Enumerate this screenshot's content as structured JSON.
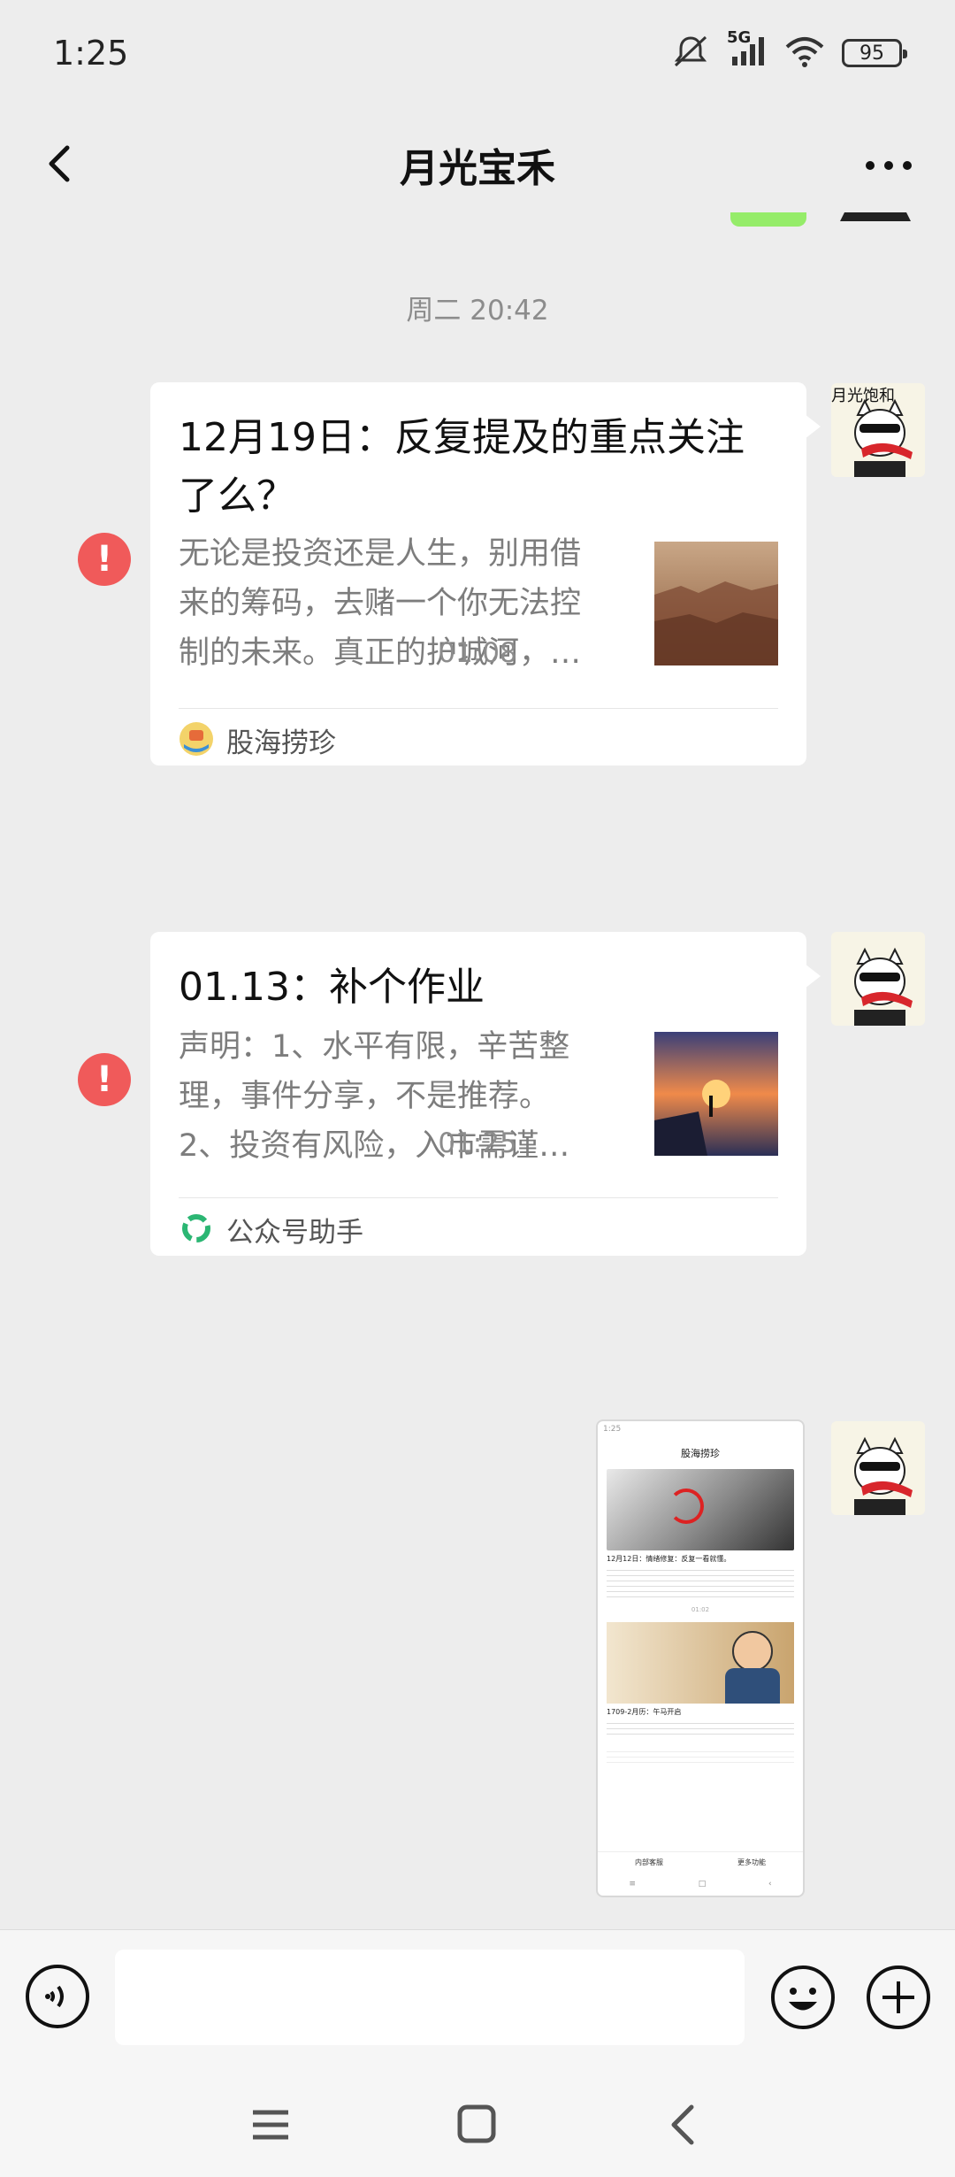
{
  "status_bar": {
    "time": "1:25",
    "network": "5G",
    "battery": "95"
  },
  "header": {
    "title": "月光宝禾",
    "back_icon": "chevron-left-icon",
    "more_icon": "more-dots-icon"
  },
  "messages": [
    {
      "timestamp": "周二 20:42",
      "title": "12月19日：反复提及的重点关注了么？",
      "title_lines": [
        "12月19日：反复提及的重点关注",
        "了么？"
      ],
      "desc_lines": [
        "无论是投资还是人生，别用借",
        "来的筹码，去赌一个你无法控",
        "制的未来。真正的护城河，…"
      ],
      "source": "股海捞珍",
      "status": "!"
    },
    {
      "timestamp": "01:08",
      "title": "01.13：补个作业",
      "desc_lines": [
        "声明：1、水平有限，辛苦整",
        "理，事件分享，不是推荐。",
        "2、投资有风险，入市需谨…"
      ],
      "source": "公众号助手",
      "status": "!"
    },
    {
      "timestamp": "01:25"
    }
  ],
  "avatar_label": "月光饱和",
  "screenshot": {
    "top_title": "股海捞珍",
    "card1_title": "12月12日：情绪修复：反复一看就懂。",
    "divider_text": "01:02",
    "card2_title": "1709-2月历：午马开启",
    "footer_left": "内部客服",
    "footer_right": "更多功能"
  },
  "input_bar": {
    "placeholder": "",
    "voice_icon": "voice-icon",
    "emoji_icon": "emoji-icon",
    "plus_icon": "plus-icon"
  },
  "system_nav": {
    "menu_icon": "menu-icon",
    "home_icon": "home-icon",
    "back_icon": "back-icon"
  },
  "colors": {
    "background": "#ededed",
    "bubble": "#ffffff",
    "error": "#f05a5a",
    "sent_green": "#95ec69"
  }
}
